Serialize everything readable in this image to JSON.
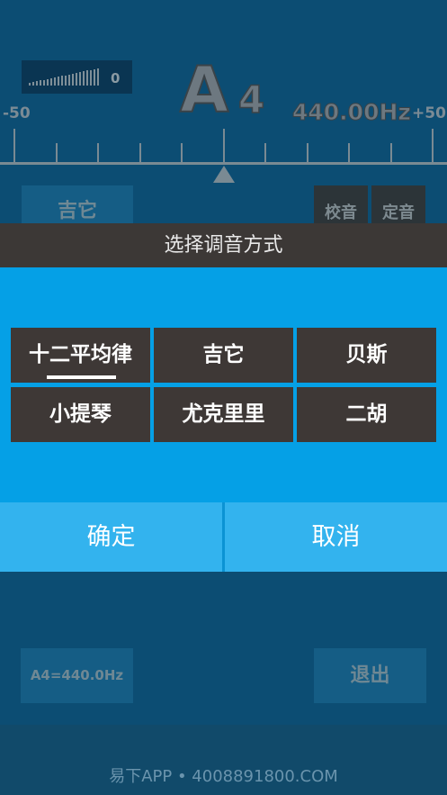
{
  "meter": {
    "value": "0",
    "level": 0
  },
  "note": {
    "letter": "A",
    "octave": "4",
    "frequency": "440.00Hz"
  },
  "scale": {
    "min_label": "-50",
    "max_label": "+50",
    "offset_cents": 0
  },
  "background_buttons": {
    "instrument": "吉它",
    "calibrate": "校音",
    "fixed_tone": "定音",
    "reference": "A4=440.0Hz",
    "exit": "退出"
  },
  "dialog": {
    "title": "选择调音方式",
    "options": [
      "十二平均律",
      "吉它",
      "贝斯",
      "小提琴",
      "尤克里里",
      "二胡"
    ],
    "selected_index": 0,
    "confirm": "确定",
    "cancel": "取消"
  },
  "footer": {
    "text": "易下APP • 4008891800.COM"
  },
  "colors": {
    "dialog_body": "#05a0e6",
    "dialog_title": "#3c3836",
    "option_bg": "#3e3836",
    "button_bg": "#33b3ee"
  }
}
